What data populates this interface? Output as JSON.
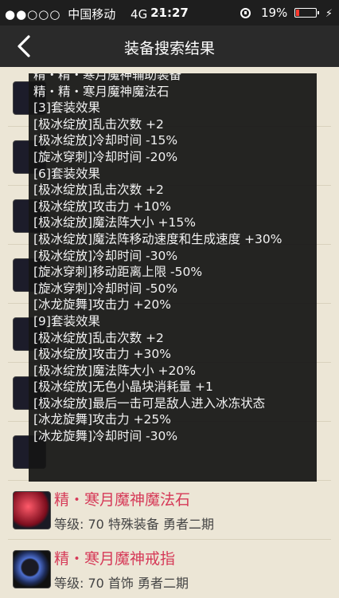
{
  "status_bar": {
    "signal_dots": "●●○○○",
    "carrier": "中国移动",
    "network": "4G",
    "activity": "⁘",
    "time": "21:27",
    "battery_text": "19%",
    "battery_level": 0.19,
    "battery_color": "#ff3b30"
  },
  "nav": {
    "title": "装备搜索结果",
    "back_icon": "chevron-left-icon"
  },
  "tooltip_lines": [
    "精・精・寒月魔神辅助装备",
    "精・精・寒月魔神魔法石",
    "[3]套装效果",
    "[极冰绽放]乱击次数 +2",
    "[极冰绽放]冷却时间 -15%",
    "[旋冰穿刺]冷却时间 -20%",
    "[6]套装效果",
    "[极冰绽放]乱击次数 +2",
    "[极冰绽放]攻击力 +10%",
    "[极冰绽放]魔法阵大小 +15%",
    "[极冰绽放]魔法阵移动速度和生成速度 +30%",
    "[极冰绽放]冷却时间 -30%",
    "[旋冰穿刺]移动距离上限 -50%",
    "[旋冰穿刺]冷却时间 -50%",
    "[冰龙旋舞]攻击力 +20%",
    "[9]套装效果",
    "[极冰绽放]乱击次数 +2",
    "[极冰绽放]攻击力 +30%",
    "[极冰绽放]魔法阵大小 +20%",
    "[极冰绽放]无色小晶块消耗量 +1",
    "[极冰绽放]最后一击可是敌人进入冰冻状态",
    "[冰龙旋舞]攻击力 +25%",
    "[冰龙旋舞]冷却时间 -30%"
  ],
  "items": [
    {
      "name": "精・寒月魔神魔法石",
      "meta": "等级: 70 特殊装备 勇者二期"
    },
    {
      "name": "精・寒月魔神戒指",
      "meta": "等级: 70 首饰 勇者二期"
    }
  ],
  "colors": {
    "item_name": "#d63a58",
    "background": "#ece6d6",
    "nav": "#2a2a2a"
  }
}
